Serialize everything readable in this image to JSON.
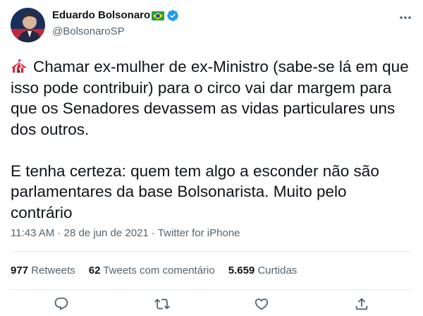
{
  "user": {
    "name": "Eduardo Bolsonaro",
    "handle": "@BolsonaroSP"
  },
  "tweet": {
    "paragraph1": "Chamar ex-mulher de ex-Ministro (sabe-se lá em que isso pode contribuir) para o circo vai dar margem para que os Senadores devassem as vidas particulares uns dos outros.",
    "paragraph2": "E tenha certeza: quem tem algo a esconder não são parlamentares da base Bolsonarista. Muito pelo contrário",
    "emoji": "circus-tent-icon"
  },
  "meta": {
    "time": "11:43 AM",
    "sep1": " · ",
    "date": "28 de jun de 2021",
    "sep2": " · ",
    "source": "Twitter for iPhone"
  },
  "stats": {
    "retweets_count": "977",
    "retweets_label": "Retweets",
    "quotes_count": "62",
    "quotes_label": "Tweets com comentário",
    "likes_count": "5.659",
    "likes_label": "Curtidas"
  },
  "icons": {
    "verified": "verified-badge-icon",
    "flag": "brazil-flag-icon",
    "more": "more-options-icon",
    "reply": "reply-icon",
    "retweet": "retweet-icon",
    "like": "like-icon",
    "share": "share-icon"
  },
  "colors": {
    "text": "#0f1419",
    "secondary": "#536471",
    "verified": "#1d9bf0",
    "divider": "#e6ecf0"
  }
}
